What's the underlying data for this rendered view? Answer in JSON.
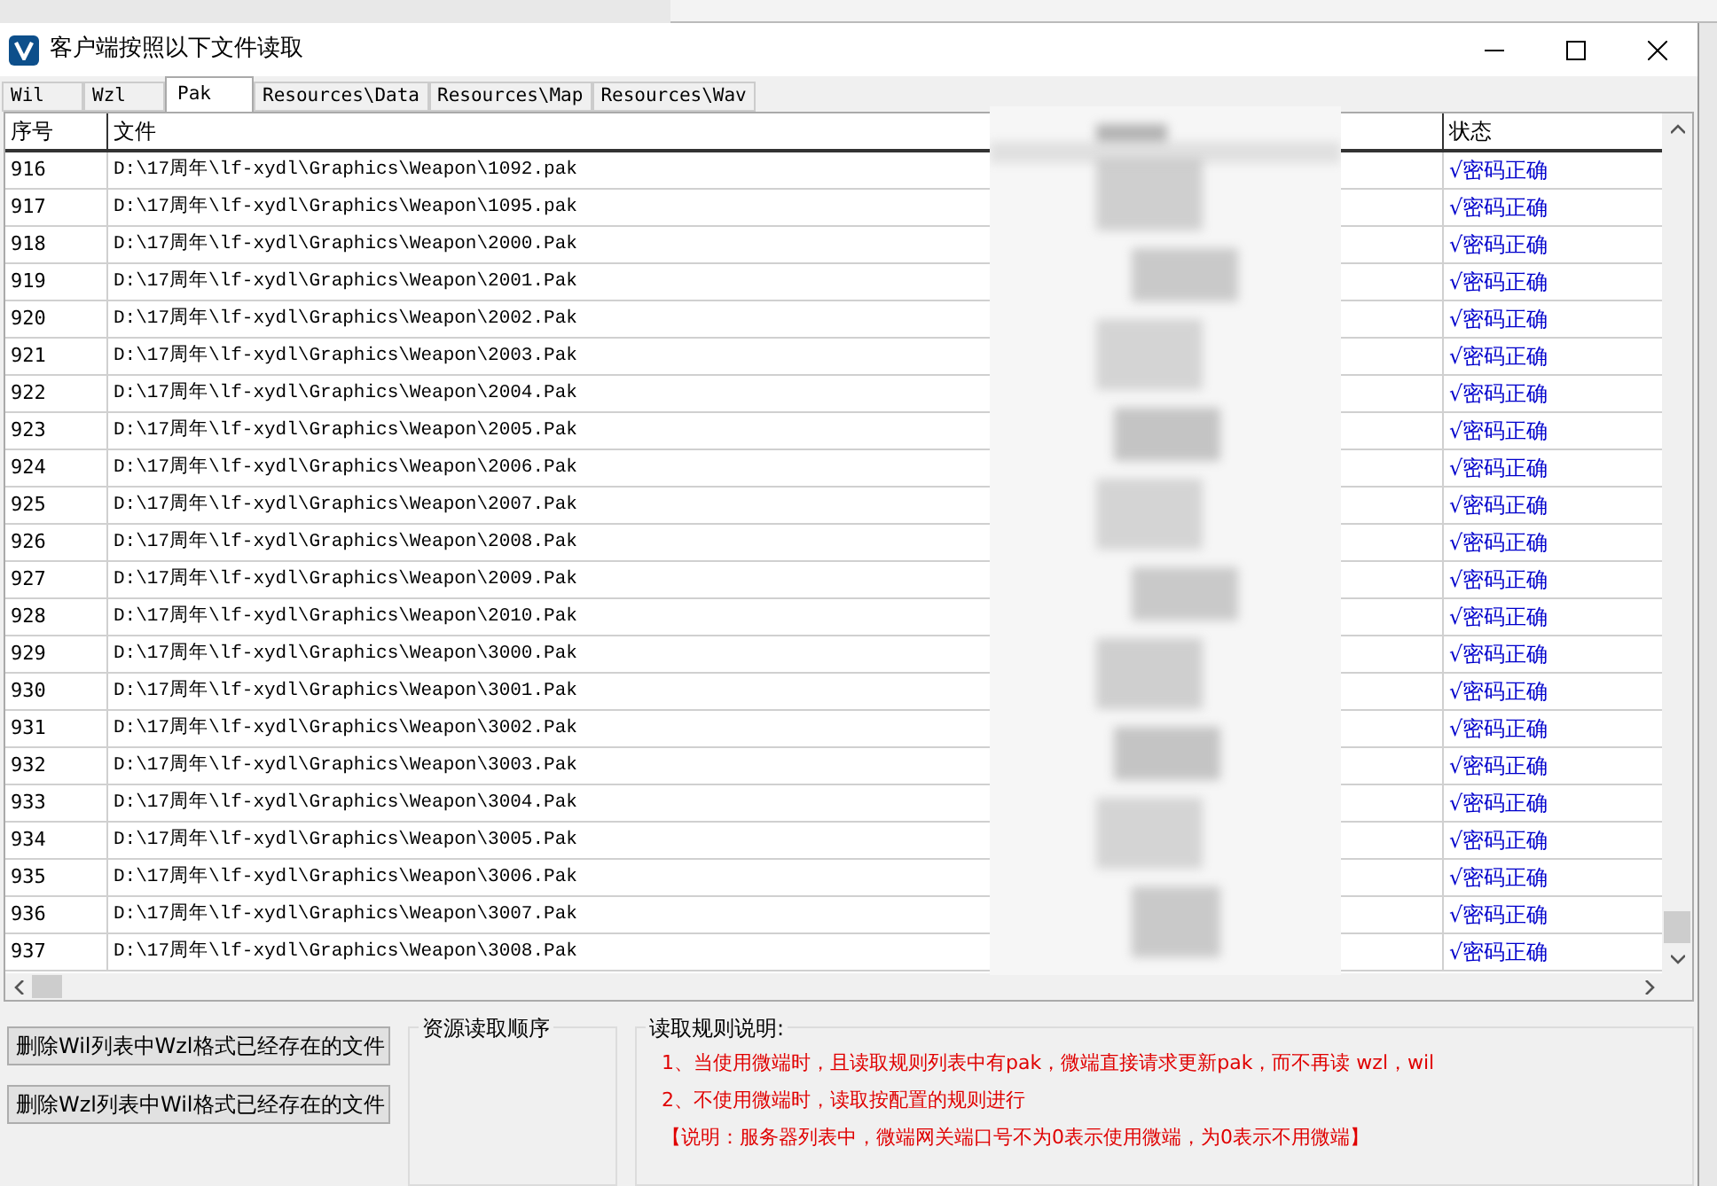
{
  "window": {
    "title": "客户端按照以下文件读取"
  },
  "tabs": [
    {
      "label": "Wil",
      "selected": false
    },
    {
      "label": "Wzl",
      "selected": false
    },
    {
      "label": "Pak",
      "selected": true
    },
    {
      "label": "Resources\\Data",
      "selected": false
    },
    {
      "label": "Resources\\Map",
      "selected": false
    },
    {
      "label": "Resources\\Wav",
      "selected": false
    }
  ],
  "table": {
    "columns": [
      "序号",
      "文件",
      "状态"
    ],
    "rows": [
      {
        "index": "916",
        "file": "D:\\17周年\\lf-xydl\\Graphics\\Weapon\\1092.pak",
        "status": "√密码正确"
      },
      {
        "index": "917",
        "file": "D:\\17周年\\lf-xydl\\Graphics\\Weapon\\1095.pak",
        "status": "√密码正确"
      },
      {
        "index": "918",
        "file": "D:\\17周年\\lf-xydl\\Graphics\\Weapon\\2000.Pak",
        "status": "√密码正确"
      },
      {
        "index": "919",
        "file": "D:\\17周年\\lf-xydl\\Graphics\\Weapon\\2001.Pak",
        "status": "√密码正确"
      },
      {
        "index": "920",
        "file": "D:\\17周年\\lf-xydl\\Graphics\\Weapon\\2002.Pak",
        "status": "√密码正确"
      },
      {
        "index": "921",
        "file": "D:\\17周年\\lf-xydl\\Graphics\\Weapon\\2003.Pak",
        "status": "√密码正确"
      },
      {
        "index": "922",
        "file": "D:\\17周年\\lf-xydl\\Graphics\\Weapon\\2004.Pak",
        "status": "√密码正确"
      },
      {
        "index": "923",
        "file": "D:\\17周年\\lf-xydl\\Graphics\\Weapon\\2005.Pak",
        "status": "√密码正确"
      },
      {
        "index": "924",
        "file": "D:\\17周年\\lf-xydl\\Graphics\\Weapon\\2006.Pak",
        "status": "√密码正确"
      },
      {
        "index": "925",
        "file": "D:\\17周年\\lf-xydl\\Graphics\\Weapon\\2007.Pak",
        "status": "√密码正确"
      },
      {
        "index": "926",
        "file": "D:\\17周年\\lf-xydl\\Graphics\\Weapon\\2008.Pak",
        "status": "√密码正确"
      },
      {
        "index": "927",
        "file": "D:\\17周年\\lf-xydl\\Graphics\\Weapon\\2009.Pak",
        "status": "√密码正确"
      },
      {
        "index": "928",
        "file": "D:\\17周年\\lf-xydl\\Graphics\\Weapon\\2010.Pak",
        "status": "√密码正确"
      },
      {
        "index": "929",
        "file": "D:\\17周年\\lf-xydl\\Graphics\\Weapon\\3000.Pak",
        "status": "√密码正确"
      },
      {
        "index": "930",
        "file": "D:\\17周年\\lf-xydl\\Graphics\\Weapon\\3001.Pak",
        "status": "√密码正确"
      },
      {
        "index": "931",
        "file": "D:\\17周年\\lf-xydl\\Graphics\\Weapon\\3002.Pak",
        "status": "√密码正确"
      },
      {
        "index": "932",
        "file": "D:\\17周年\\lf-xydl\\Graphics\\Weapon\\3003.Pak",
        "status": "√密码正确"
      },
      {
        "index": "933",
        "file": "D:\\17周年\\lf-xydl\\Graphics\\Weapon\\3004.Pak",
        "status": "√密码正确"
      },
      {
        "index": "934",
        "file": "D:\\17周年\\lf-xydl\\Graphics\\Weapon\\3005.Pak",
        "status": "√密码正确"
      },
      {
        "index": "935",
        "file": "D:\\17周年\\lf-xydl\\Graphics\\Weapon\\3006.Pak",
        "status": "√密码正确"
      },
      {
        "index": "936",
        "file": "D:\\17周年\\lf-xydl\\Graphics\\Weapon\\3007.Pak",
        "status": "√密码正确"
      },
      {
        "index": "937",
        "file": "D:\\17周年\\lf-xydl\\Graphics\\Weapon\\3008.Pak",
        "status": "√密码正确"
      }
    ]
  },
  "buttons": [
    "删除Wil列表中Wzl格式已经存在的文件",
    "删除Wzl列表中Wil格式已经存在的文件"
  ],
  "order_group": {
    "title": "资源读取顺序"
  },
  "rules_group": {
    "title": "读取规则说明:",
    "lines": [
      "1、当使用微端时，且读取规则列表中有pak，微端直接请求更新pak，而不再读 wzl，wil",
      "2、不使用微端时，读取按配置的规则进行",
      "【说明：服务器列表中，微端网关端口号不为0表示使用微端，为0表示不用微端】"
    ]
  }
}
